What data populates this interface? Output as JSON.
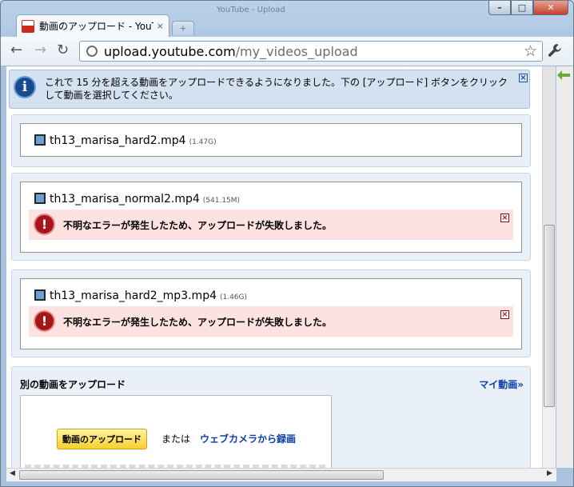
{
  "window": {
    "controls": {
      "minimize": "–",
      "maximize": "□",
      "close": "✕"
    }
  },
  "tab": {
    "title": "動画のアップロード - YouTube",
    "close": "×",
    "new_tab": "+",
    "background_title": "YouTube - Upload"
  },
  "toolbar": {
    "back": "←",
    "forward": "→",
    "reload": "↻",
    "url_host": "upload.youtube.com",
    "url_path": "/my_videos_upload",
    "star": "☆",
    "wrench": "🔧"
  },
  "notice": {
    "icon_glyph": "i",
    "text": "これで 15 分を超える動画をアップロードできるようになりました。下の [アップロード] ボタンをクリックして動画を選択してください。",
    "close": "×"
  },
  "uploads": [
    {
      "filename": "th13_marisa_hard2.mp4",
      "size": "(1.47G)",
      "error": ""
    },
    {
      "filename": "th13_marisa_normal2.mp4",
      "size": "(541.15M)",
      "error": "不明なエラーが発生したため、アップロードが失敗しました。"
    },
    {
      "filename": "th13_marisa_hard2_mp3.mp4",
      "size": "(1.46G)",
      "error": "不明なエラーが発生したため、アップロードが失敗しました。"
    }
  ],
  "error_icon_glyph": "!",
  "error_close": "×",
  "another_upload": {
    "title": "別の動画をアップロード",
    "my_videos_link": "マイ動画»",
    "upload_button": "動画のアップロード",
    "or_text": "または",
    "webcam_link": "ウェブカメラから録画"
  },
  "scrollbars": {
    "left_arrow": "◀",
    "right_arrow": "▶"
  },
  "colors": {
    "notice_bg": "#d3e1f1",
    "error_bg": "#fde2e2",
    "link": "#0a3ea8",
    "upload_button": "#f7cf2f"
  },
  "icons": {
    "info": "info-icon",
    "error": "error-icon",
    "file": "film-icon",
    "close": "close-icon"
  }
}
